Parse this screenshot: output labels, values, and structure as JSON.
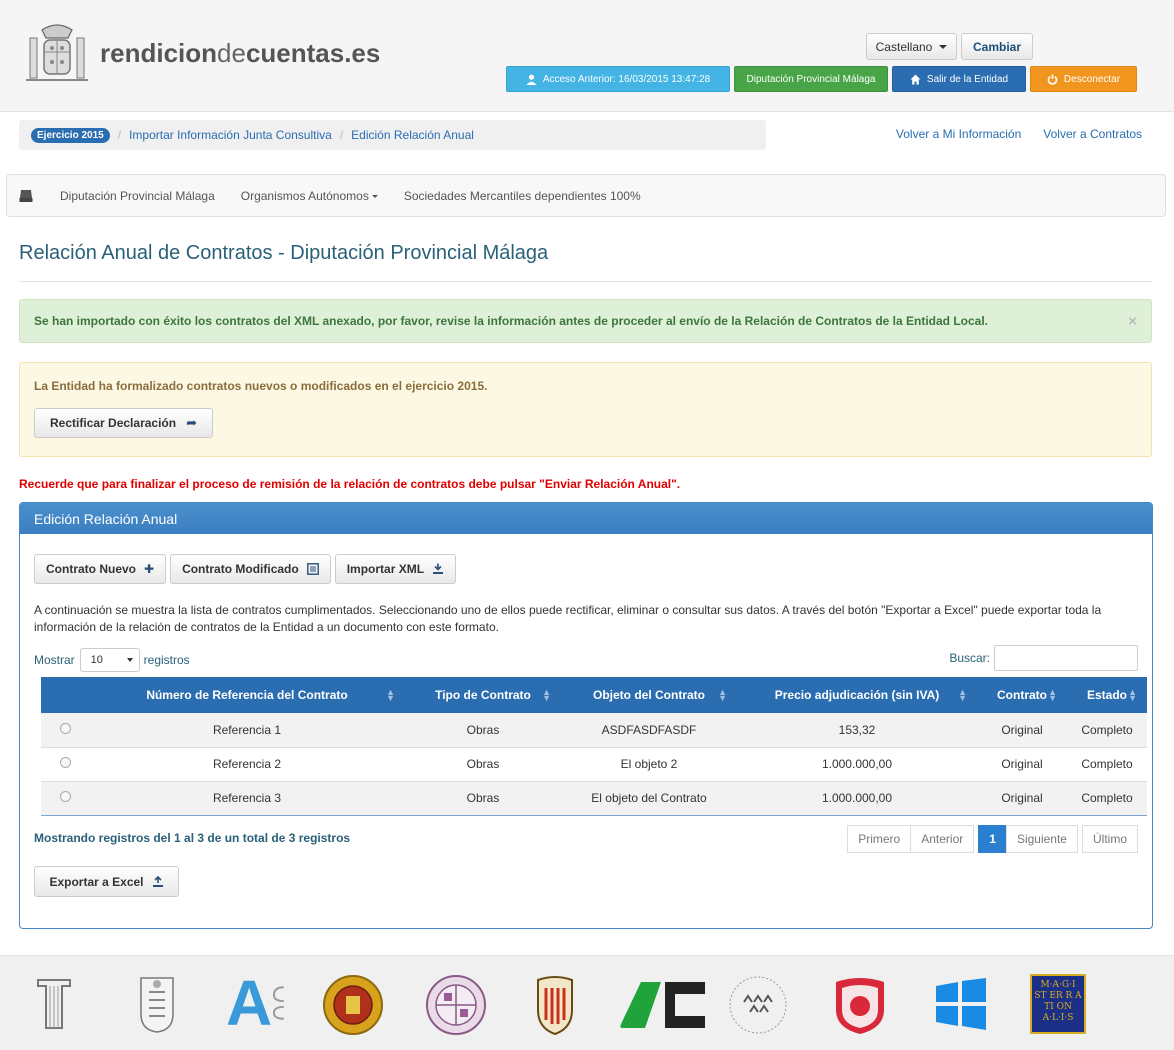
{
  "header": {
    "brand_bold1": "rendicion",
    "brand_light": "de",
    "brand_bold2": "cuentas.es",
    "language": "Castellano",
    "change_label": "Cambiar",
    "acceso_label": "Acceso Anterior: 16/03/2015 13:47:28",
    "entity_label": "Diputación Provincial Málaga",
    "salir_label": "Salir de la Entidad",
    "desconectar_label": "Desconectar"
  },
  "breadcrumb": {
    "badge": "Ejercicio 2015",
    "item1": "Importar Información Junta Consultiva",
    "item2": "Edición Relación Anual"
  },
  "toplinks": {
    "mi_info": "Volver a Mi Información",
    "contratos": "Volver a Contratos"
  },
  "nav": {
    "item1": "Diputación Provincial Málaga",
    "item2": "Organismos Autónomos",
    "item3": "Sociedades Mercantiles dependientes 100%"
  },
  "page_title": "Relación Anual de Contratos - Diputación Provincial Málaga",
  "alert_success": "Se han importado con éxito los contratos del XML anexado, por favor, revise la información antes de proceder al envío de la Relación de Contratos de la Entidad Local.",
  "alert_close": "×",
  "alert_warning": "La Entidad ha formalizado contratos nuevos o modificados en el ejercicio 2015.",
  "rectificar_label": "Rectificar Declaración",
  "reminder": "Recuerde que para finalizar el proceso de remisión de la relación de contratos debe pulsar \"Enviar Relación Anual\".",
  "panel": {
    "title": "Edición Relación Anual",
    "btn_nuevo": "Contrato Nuevo",
    "btn_modificado": "Contrato Modificado",
    "btn_importar": "Importar XML",
    "description": "A continuación se muestra la lista de contratos cumplimentados. Seleccionando uno de ellos puede rectificar, eliminar o consultar sus datos. A través del botón \"Exportar a Excel\" puede exportar toda la información de la relación de contratos de la Entidad a un documento con este formato.",
    "mostrar": "Mostrar",
    "page_size": "10",
    "registros": "registros",
    "buscar": "Buscar:",
    "columns": [
      "Número de Referencia del Contrato",
      "Tipo de Contrato",
      "Objeto del Contrato",
      "Precio adjudicación (sin IVA)",
      "Contrato",
      "Estado"
    ],
    "rows": [
      {
        "ref": "Referencia 1",
        "tipo": "Obras",
        "objeto": "ASDFASDFASDF",
        "precio": "153,32",
        "contrato": "Original",
        "estado": "Completo"
      },
      {
        "ref": "Referencia 2",
        "tipo": "Obras",
        "objeto": "El objeto 2",
        "precio": "1.000.000,00",
        "contrato": "Original",
        "estado": "Completo"
      },
      {
        "ref": "Referencia 3",
        "tipo": "Obras",
        "objeto": "El objeto del Contrato",
        "precio": "1.000.000,00",
        "contrato": "Original",
        "estado": "Completo"
      }
    ],
    "info": "Mostrando registros del 1 al 3 de un total de 3 registros",
    "pager": {
      "first": "Primero",
      "prev": "Anterior",
      "current": "1",
      "next": "Siguiente",
      "last": "Último"
    },
    "excel_label": "Exportar a Excel"
  },
  "footer_logo_text": {
    "ac": "A",
    "magistratus": "M·A·G·I ST ER R A TI ON A·L·I·S"
  }
}
